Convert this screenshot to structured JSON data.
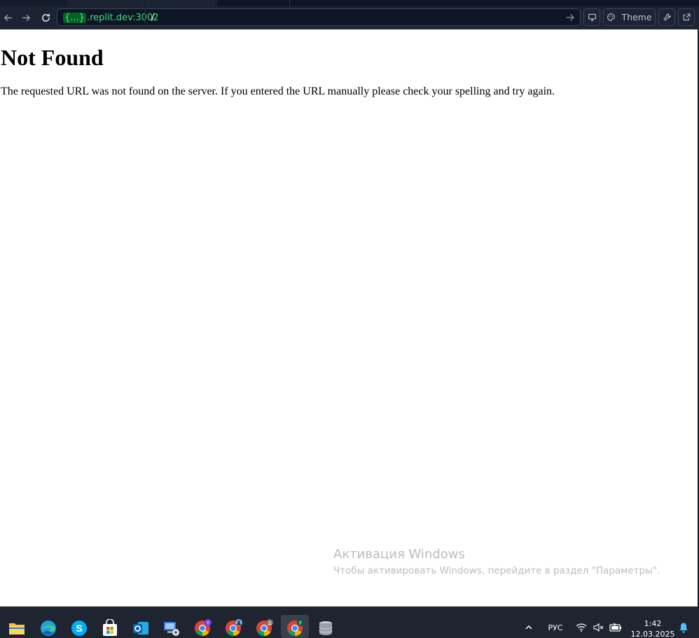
{
  "browser": {
    "url": {
      "domain_badge": "{...}",
      "domain": ".replit.dev:3002",
      "path": "/"
    },
    "toolbar": {
      "theme_label": "Theme"
    },
    "icons": {
      "back": "arrow-left-icon",
      "forward": "arrow-right-icon",
      "reload": "refresh-icon",
      "go": "arrow-right-icon",
      "devices": "monitor-icon",
      "theme": "palette-icon",
      "devtools": "wrench-icon",
      "open_new_tab": "external-link-icon"
    }
  },
  "page": {
    "heading": "Not Found",
    "message": "The requested URL was not found on the server. If you entered the URL manually please check your spelling and try again."
  },
  "watermark": {
    "title": "Активация Windows",
    "subtitle": "Чтобы активировать Windows, перейдите в раздел \"Параметры\"."
  },
  "taskbar": {
    "apps": [
      "file-explorer-icon",
      "edge-icon",
      "skype-icon",
      "store-icon",
      "outlook-icon",
      "remote-desktop-icon",
      "chrome-profile-y-icon",
      "chrome-profile-person-icon",
      "chrome-profile-d-icon",
      "chrome-profile-f-icon",
      "database-icon"
    ],
    "profile_badges": {
      "y": "Y",
      "d": "Д",
      "f": "F"
    },
    "language": "РУС",
    "time": "1:42",
    "date": "12.03.2025"
  },
  "colors": {
    "toolbar_bg": "#1c2333",
    "domain_green": "#3fdb7d",
    "taskbar_bg": "#1f2431"
  }
}
